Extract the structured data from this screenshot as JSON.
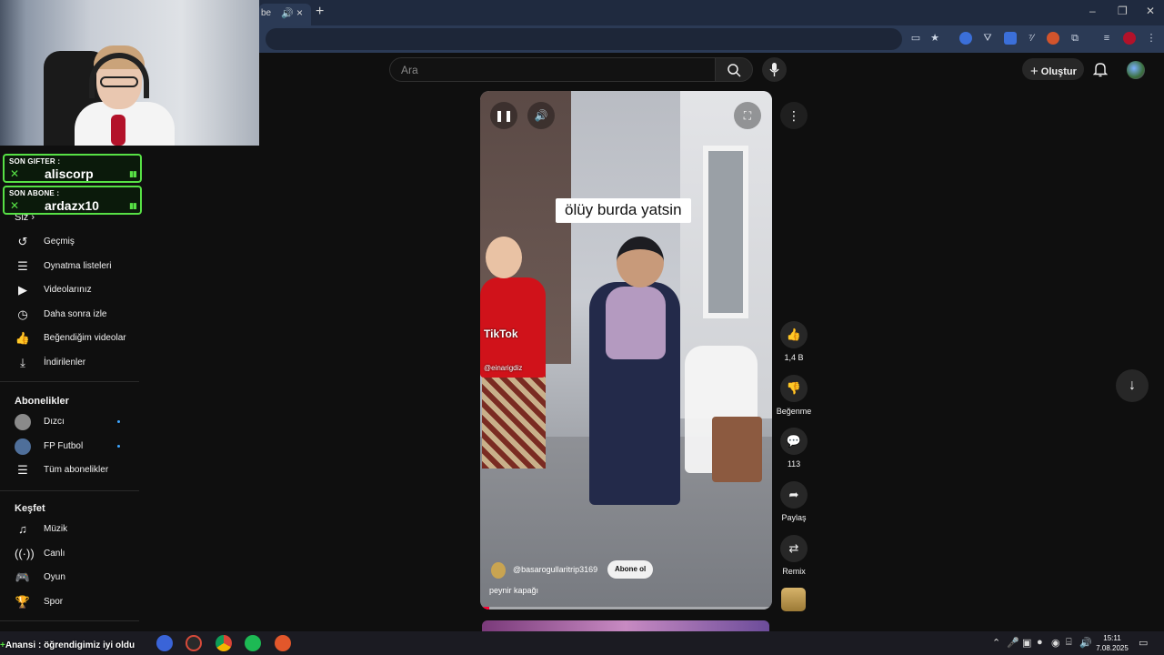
{
  "browser": {
    "tab_fragment": "be",
    "tab_audio_icon": "speaker-icon",
    "tab_close": "×",
    "new_tab": "+",
    "window_controls": [
      "–",
      "❐",
      "✕"
    ]
  },
  "youtube_header": {
    "search_placeholder": "Ara",
    "create_label": "Oluştur",
    "create_icon": "+"
  },
  "overlay": {
    "last_gifter": {
      "title": "SON GIFTER :",
      "name": "aliscorp"
    },
    "last_subscriber": {
      "title": "SON ABONE :",
      "name": "ardazx10"
    },
    "ticker": {
      "prefix": "Anansi",
      "text": " : öğrendigimiz iyi oldu"
    }
  },
  "sidebar": {
    "you_label": "Siz",
    "you_chevron": "›",
    "you_items": [
      {
        "icon": "history-icon",
        "label": "Geçmiş"
      },
      {
        "icon": "playlist-icon",
        "label": "Oynatma listeleri"
      },
      {
        "icon": "your-videos-icon",
        "label": "Videolarınız"
      },
      {
        "icon": "watch-later-icon",
        "label": "Daha sonra izle"
      },
      {
        "icon": "liked-videos-icon",
        "label": "Beğendiğim videolar"
      },
      {
        "icon": "download-icon",
        "label": "İndirilenler"
      }
    ],
    "subscriptions_heading": "Abonelikler",
    "subscriptions": [
      {
        "label": "Dızcı",
        "new_content": true
      },
      {
        "label": "FP Futbol",
        "new_content": true
      },
      {
        "label": "Tüm abonelikler",
        "new_content": false
      }
    ],
    "explore_heading": "Keşfet",
    "explore_items": [
      {
        "icon": "music-icon",
        "label": "Müzik"
      },
      {
        "icon": "live-icon",
        "label": "Canlı"
      },
      {
        "icon": "gaming-icon",
        "label": "Oyun"
      },
      {
        "icon": "trophy-icon",
        "label": "Spor"
      }
    ]
  },
  "short": {
    "caption": "ölüy burda yatsin",
    "watermark": "TikTok",
    "watermark_handle": "@einarigdiz",
    "channel_handle": "@basarogullaritrip3169",
    "subscribe_label": "Abone ol",
    "title": "peynir kapağı",
    "progress": 0.03,
    "playing": true
  },
  "actions": {
    "likes": "1,4 B",
    "dislike_label": "Beğenme",
    "comments": "113",
    "share_label": "Paylaş",
    "remix_label": "Remix"
  },
  "taskbar": {
    "time": "15:11",
    "date": "7.08.2025"
  },
  "colors": {
    "accent_green": "#57e045",
    "youtube_red": "#ff0033",
    "background": "#0f0f0f"
  }
}
